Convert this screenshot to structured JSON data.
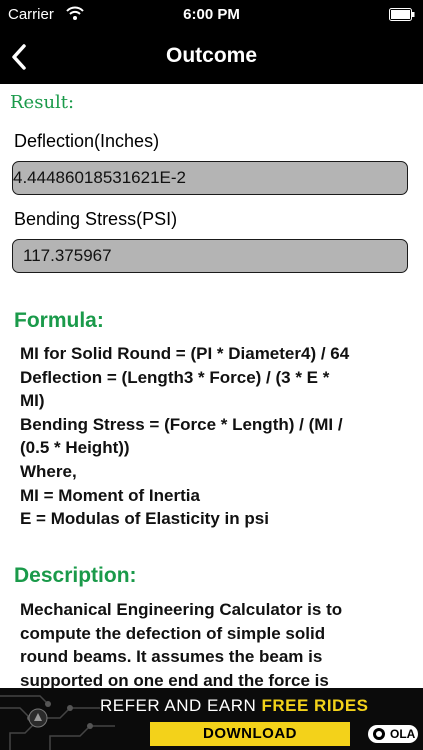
{
  "status_bar": {
    "carrier": "Carrier",
    "time": "6:00 PM"
  },
  "nav": {
    "title": "Outcome"
  },
  "result": {
    "heading": "Result:",
    "deflection_label": "Deflection(Inches)",
    "deflection_value": "4.44486018531621E-2",
    "stress_label": "Bending Stress(PSI)",
    "stress_value": "117.375967"
  },
  "formula": {
    "heading": "Formula:",
    "lines": [
      "MI for Solid Round = (PI * Diameter4) / 64",
      "Deflection = (Length3 * Force) / (3 * E *",
      "MI)",
      "Bending Stress = (Force * Length) / (MI /",
      "(0.5 * Height))",
      "Where,",
      "MI = Moment of Inertia",
      "E = Modulas of Elasticity in psi"
    ]
  },
  "description": {
    "heading": "Description:",
    "lines": [
      "Mechanical Engineering Calculator is to",
      "compute the defection of simple solid",
      "round beams. It assumes the beam is",
      "supported on one end and the force is"
    ]
  },
  "ad": {
    "text_prefix": "REFER AND EARN",
    "text_highlight": "FREE RIDES",
    "button_label": "DOWNLOAD",
    "brand": "OLA"
  },
  "colors": {
    "accent_green": "#1a9a4a",
    "bar_black": "#000000",
    "field_gray": "#b4b4b4",
    "ad_yellow": "#f3d21a"
  }
}
